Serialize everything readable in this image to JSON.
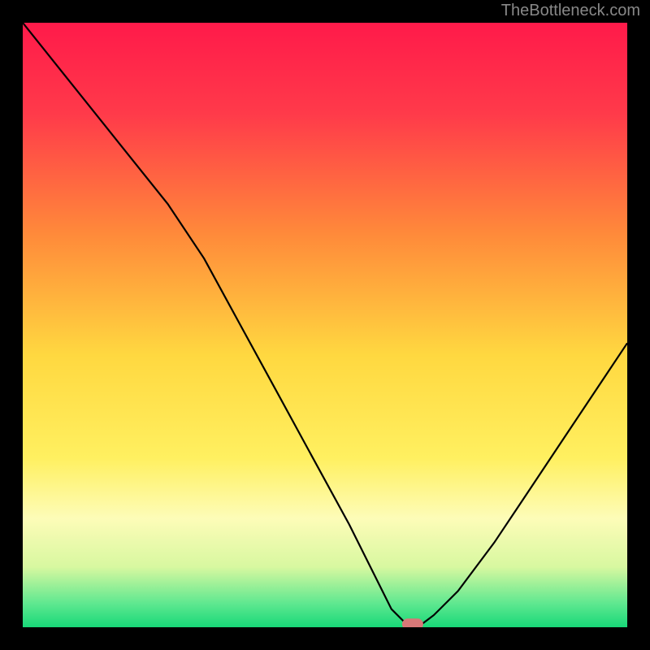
{
  "watermark": "TheBottleneck.com",
  "chart_data": {
    "type": "line",
    "title": "",
    "xlabel": "",
    "ylabel": "",
    "xlim": [
      0,
      100
    ],
    "ylim": [
      0,
      100
    ],
    "grid": false,
    "background_gradient": [
      {
        "stop": 0.0,
        "color": "#ff1a4a"
      },
      {
        "stop": 0.15,
        "color": "#ff3a4a"
      },
      {
        "stop": 0.35,
        "color": "#ff8a3a"
      },
      {
        "stop": 0.55,
        "color": "#ffd840"
      },
      {
        "stop": 0.72,
        "color": "#fff060"
      },
      {
        "stop": 0.82,
        "color": "#fdfcb8"
      },
      {
        "stop": 0.9,
        "color": "#d8f8a0"
      },
      {
        "stop": 0.96,
        "color": "#60e890"
      },
      {
        "stop": 1.0,
        "color": "#18d878"
      }
    ],
    "series": [
      {
        "name": "bottleneck-curve",
        "color": "#000000",
        "x": [
          0,
          8,
          16,
          24,
          30,
          36,
          42,
          48,
          54,
          58,
          61,
          63.5,
          66,
          68,
          72,
          78,
          84,
          90,
          96,
          100
        ],
        "y": [
          100,
          90,
          80,
          70,
          61,
          50,
          39,
          28,
          17,
          9,
          3,
          0.5,
          0.5,
          2,
          6,
          14,
          23,
          32,
          41,
          47
        ]
      }
    ],
    "marker": {
      "name": "optimal-point",
      "x": 64.5,
      "y": 0.5,
      "color": "#d87878",
      "shape": "rounded-rect"
    }
  }
}
